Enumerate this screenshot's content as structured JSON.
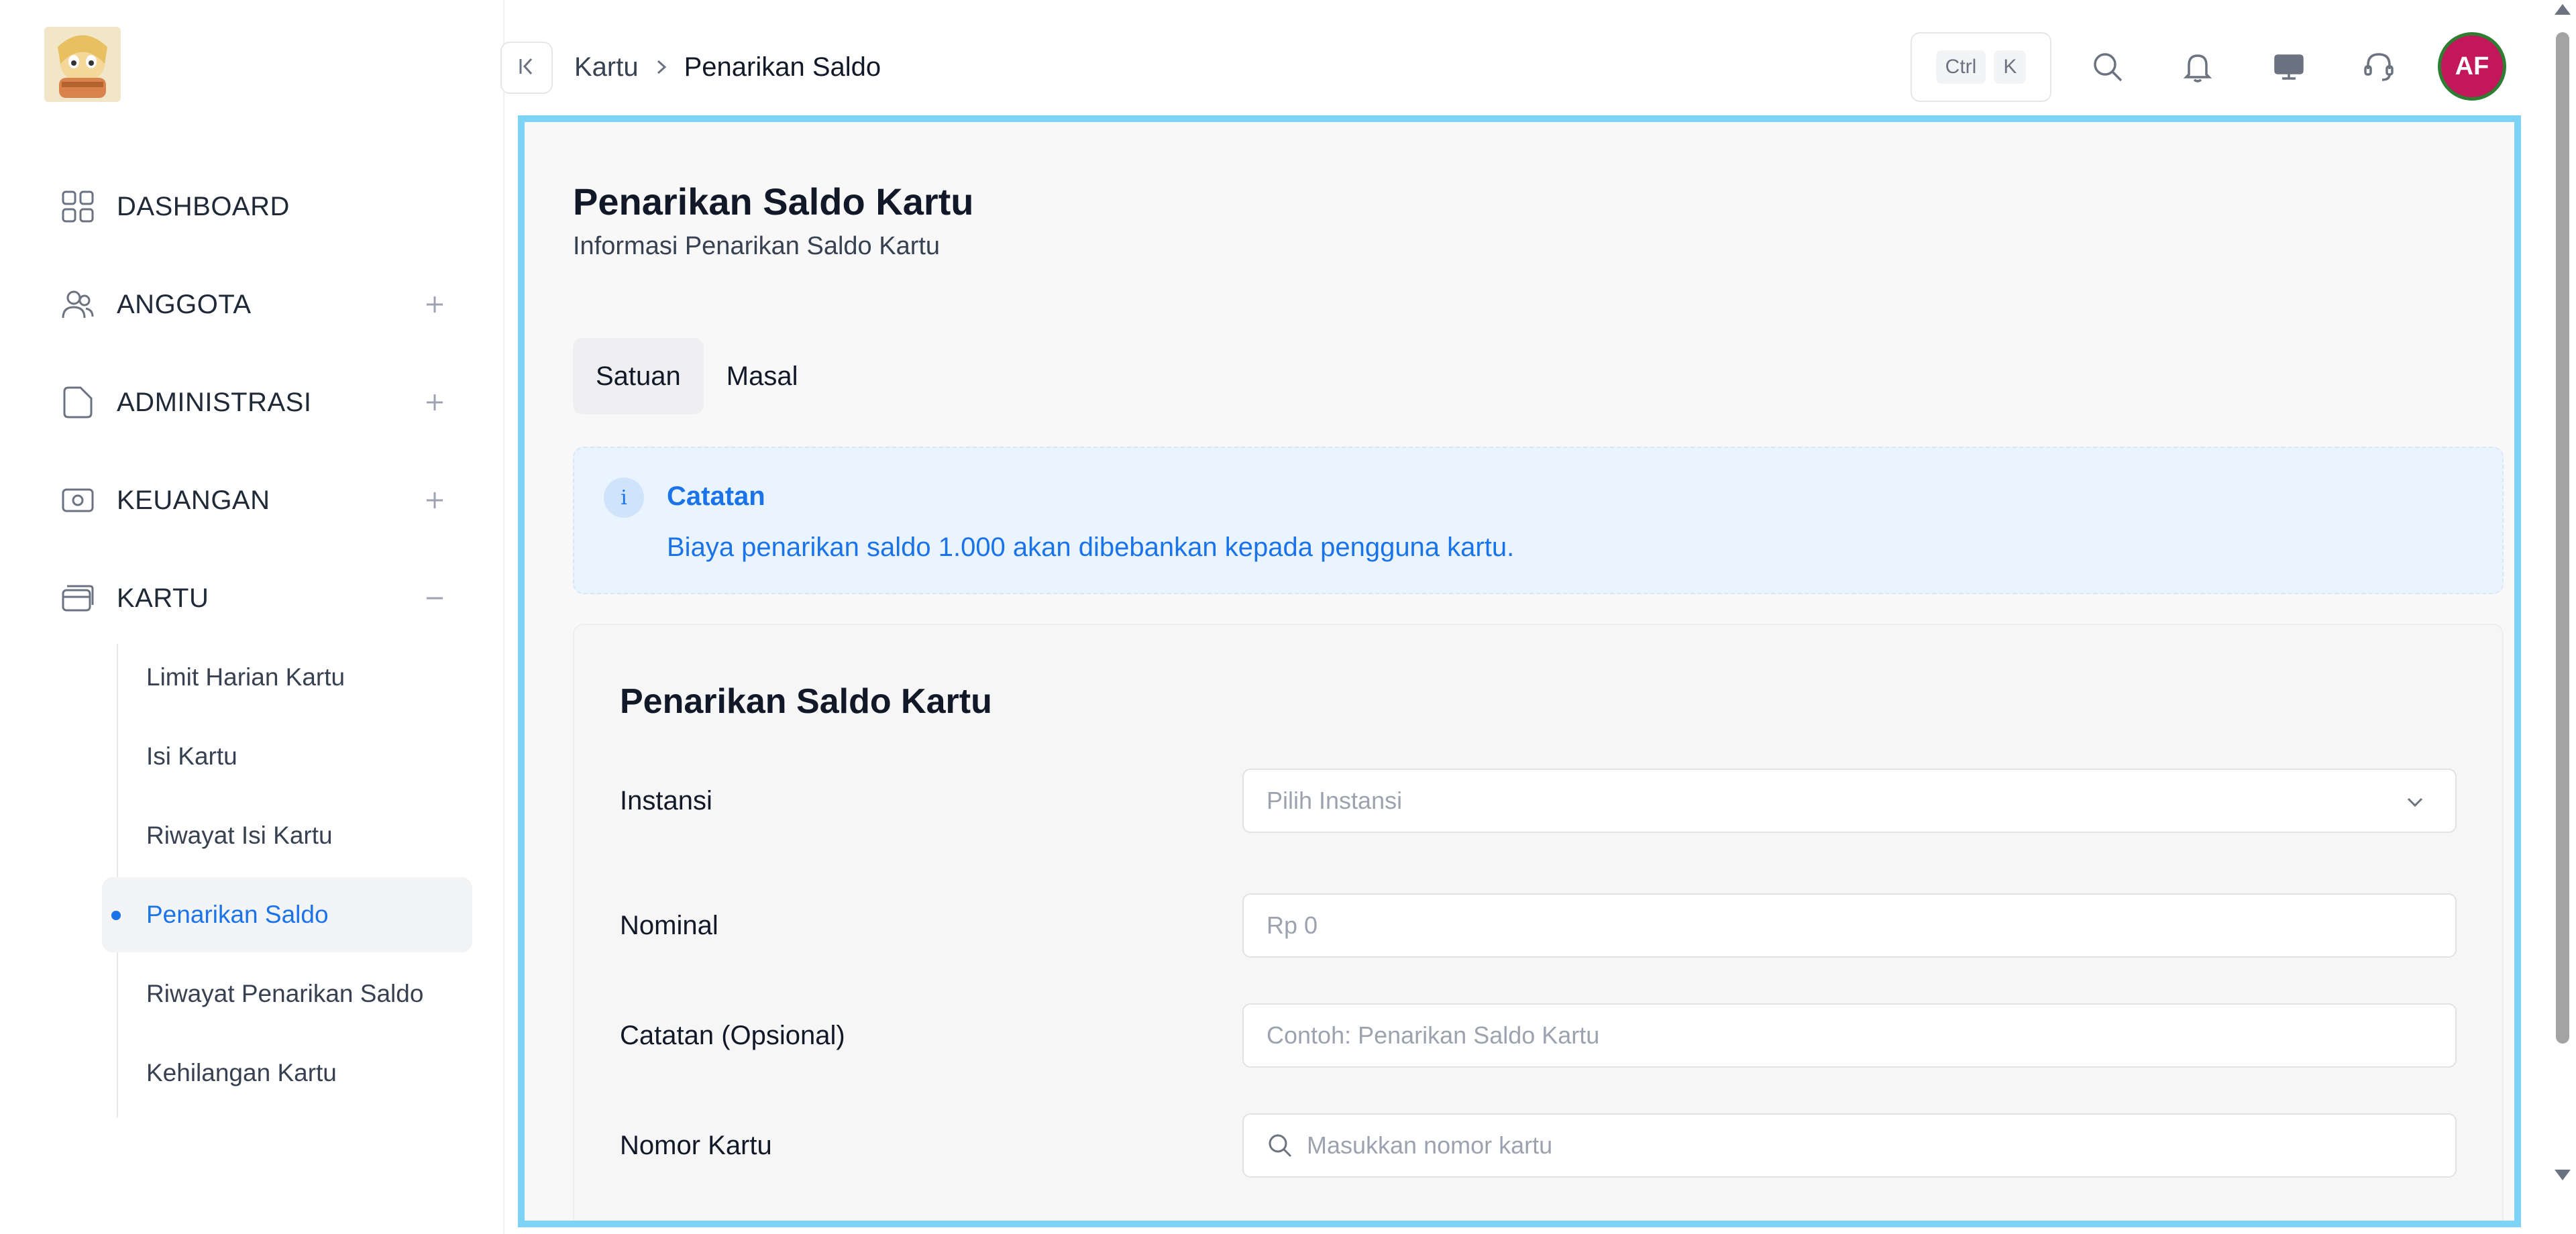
{
  "sidebar": {
    "logo_alt": "app-logo",
    "items": [
      {
        "label": "DASHBOARD",
        "icon": "dashboard-grid-icon",
        "toggle": ""
      },
      {
        "label": "ANGGOTA",
        "icon": "users-icon",
        "toggle": "+"
      },
      {
        "label": "ADMINISTRASI",
        "icon": "folder-icon",
        "toggle": "+"
      },
      {
        "label": "KEUANGAN",
        "icon": "money-icon",
        "toggle": "+"
      },
      {
        "label": "KARTU",
        "icon": "card-icon",
        "toggle": "−"
      }
    ],
    "subitems": [
      {
        "label": "Limit Harian Kartu",
        "active": false
      },
      {
        "label": "Isi Kartu",
        "active": false
      },
      {
        "label": "Riwayat Isi Kartu",
        "active": false
      },
      {
        "label": "Penarikan Saldo",
        "active": true
      },
      {
        "label": "Riwayat Penarikan Saldo",
        "active": false
      },
      {
        "label": "Kehilangan Kartu",
        "active": false
      }
    ]
  },
  "header": {
    "breadcrumb": [
      "Kartu",
      "Penarikan Saldo"
    ],
    "shortcut": [
      "Ctrl",
      "K"
    ],
    "avatar_initials": "AF",
    "icons": [
      "search-icon",
      "bell-icon",
      "monitor-icon",
      "headset-icon"
    ]
  },
  "page": {
    "title": "Penarikan Saldo Kartu",
    "subtitle": "Informasi Penarikan Saldo Kartu",
    "tabs": [
      {
        "label": "Satuan",
        "active": true
      },
      {
        "label": "Masal",
        "active": false
      }
    ],
    "alert": {
      "title": "Catatan",
      "text": "Biaya penarikan saldo 1.000 akan dibebankan kepada pengguna kartu.",
      "icon_text": "i"
    },
    "form": {
      "title": "Penarikan Saldo Kartu",
      "fields": [
        {
          "label": "Instansi",
          "placeholder": "Pilih Instansi",
          "type": "select"
        },
        {
          "label": "Nominal",
          "placeholder": "Rp 0",
          "type": "text"
        },
        {
          "label": "Catatan (Opsional)",
          "placeholder": "Contoh: Penarikan Saldo Kartu",
          "type": "text"
        },
        {
          "label": "Nomor Kartu",
          "placeholder": "Masukkan nomor kartu",
          "type": "search"
        }
      ]
    }
  },
  "colors": {
    "accent": "#1a73e8",
    "highlight_border": "#7dd3f5",
    "avatar_bg": "#c2185b",
    "avatar_ring": "#2e7d32"
  }
}
